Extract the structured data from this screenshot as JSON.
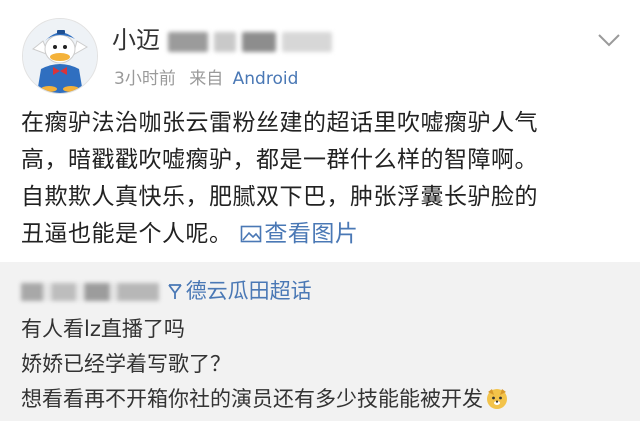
{
  "post": {
    "username": "小迈",
    "time": "3小时前",
    "source_prefix": "来自",
    "source": "Android",
    "content_lines": [
      "在瘸驴法治咖张云雷粉丝建的超话里吹嘘瘸驴人气",
      "高，暗戳戳吹嘘瘸驴，都是一群什么样的智障啊。",
      "自欺欺人真快乐，肥腻双下巴，肿张浮囊长驴脸的",
      "丑逼也能是个人呢。"
    ],
    "view_images": "查看图片"
  },
  "repost": {
    "topic": "德云瓜田超话",
    "lines": [
      "有人看lz直播了吗",
      "娇娇已经学着写歌了？",
      "想看看再不开箱你社的演员还有多少技能能被开发"
    ]
  },
  "colors": {
    "link": "#4a78b5",
    "meta": "#9a9a9a",
    "repost_bg": "#f2f2f2"
  },
  "icons": {
    "avatar": "donald-duck-avatar",
    "more": "chevron-down-icon",
    "image": "image-icon",
    "topic": "super-topic-icon",
    "emoji": "dog-face-emoji"
  }
}
